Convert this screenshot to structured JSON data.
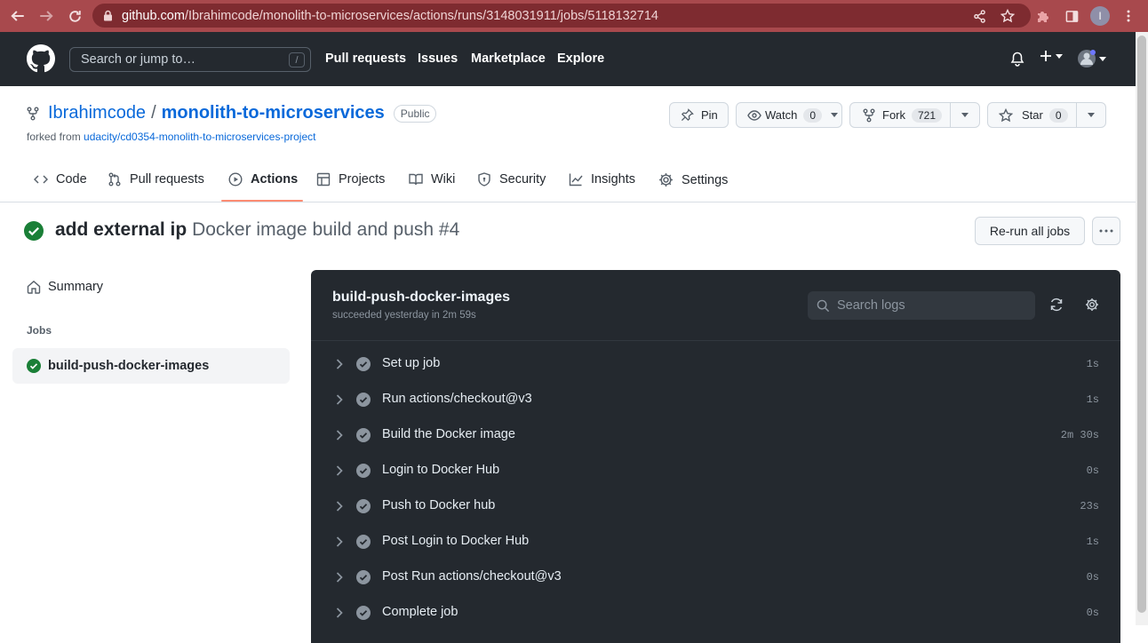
{
  "browser": {
    "url_host": "github.com",
    "url_path": "/Ibrahimcode/monolith-to-microservices/actions/runs/3148031911/jobs/5118132714",
    "profile_initial": "I",
    "chrome_color": "#a8494d"
  },
  "header": {
    "search_placeholder": "Search or jump to…",
    "search_shortcut": "/",
    "nav": [
      "Pull requests",
      "Issues",
      "Marketplace",
      "Explore"
    ],
    "plus_label": "+"
  },
  "repo": {
    "owner": "Ibrahimcode",
    "separator": "/",
    "name": "monolith-to-microservices",
    "visibility": "Public",
    "forked_from_prefix": "forked from",
    "forked_from": "udacity/cd0354-monolith-to-microservices-project",
    "pin_label": "Pin",
    "watch_label": "Watch",
    "watch_count": "0",
    "fork_label": "Fork",
    "fork_count": "721",
    "star_label": "Star",
    "star_count": "0"
  },
  "tabs": [
    {
      "label": "Code",
      "icon": "code-icon"
    },
    {
      "label": "Pull requests",
      "icon": "pull-request-icon"
    },
    {
      "label": "Actions",
      "icon": "play-icon",
      "active": true
    },
    {
      "label": "Projects",
      "icon": "table-icon"
    },
    {
      "label": "Wiki",
      "icon": "book-icon"
    },
    {
      "label": "Security",
      "icon": "shield-icon"
    },
    {
      "label": "Insights",
      "icon": "graph-icon"
    },
    {
      "label": "Settings",
      "icon": "gear-icon"
    }
  ],
  "run": {
    "commit_message": "add external ip",
    "workflow_title": "Docker image build and push #4",
    "rerun_label": "Re-run all jobs"
  },
  "sidebar": {
    "summary_label": "Summary",
    "jobs_heading": "Jobs",
    "job_label": "build-push-docker-images"
  },
  "job": {
    "name": "build-push-docker-images",
    "status": "succeeded yesterday in 2m 59s",
    "search_placeholder": "Search logs",
    "steps": [
      {
        "name": "Set up job",
        "duration": "1s"
      },
      {
        "name": "Run actions/checkout@v3",
        "duration": "1s"
      },
      {
        "name": "Build the Docker image",
        "duration": "2m 30s"
      },
      {
        "name": "Login to Docker Hub",
        "duration": "0s"
      },
      {
        "name": "Push to Docker hub",
        "duration": "23s"
      },
      {
        "name": "Post Login to Docker Hub",
        "duration": "1s"
      },
      {
        "name": "Post Run actions/checkout@v3",
        "duration": "0s"
      },
      {
        "name": "Complete job",
        "duration": "0s"
      }
    ]
  },
  "colors": {
    "success": "#1a7f37",
    "link": "#0969da",
    "header_bg": "#24292f",
    "active_tab_underline": "#fd8c73"
  }
}
